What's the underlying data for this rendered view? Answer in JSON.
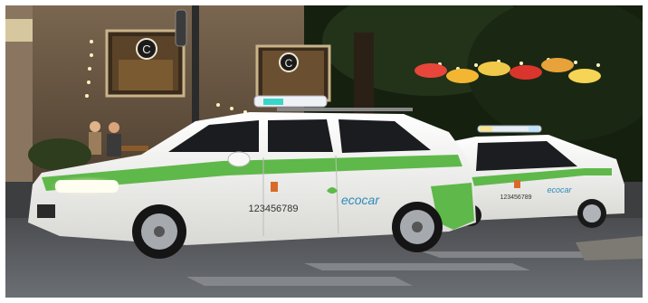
{
  "photo": {
    "taxi_front": {
      "phone": "123456789",
      "brand": "ecocar",
      "body_color": "#f2f2ef",
      "stripe_color": "#5fb84a"
    },
    "taxi_rear": {
      "phone": "123456789",
      "brand": "ecocar",
      "body_color": "#f2f2ef",
      "stripe_color": "#5fb84a"
    },
    "window_logos": [
      "C",
      "C"
    ],
    "umbrella_colors": [
      "#e8463a",
      "#f2b632",
      "#f0c84a",
      "#d9352c",
      "#e7a23a",
      "#f6d455"
    ],
    "building_color": "#6b5843",
    "tree_color": "#1d2a14",
    "road_color": "#5b5e62"
  }
}
